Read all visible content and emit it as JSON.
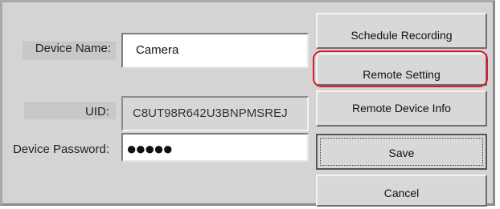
{
  "form": {
    "device_name": {
      "label": "Device Name:",
      "value": "Camera"
    },
    "uid": {
      "label": "UID:",
      "value": "C8UT98R642U3BNPMSREJ"
    },
    "password": {
      "label": "Device Password:",
      "value": "●●●●●"
    }
  },
  "buttons": {
    "schedule_recording": "Schedule Recording",
    "remote_setting": "Remote Setting",
    "remote_device_info": "Remote Device Info",
    "save": "Save",
    "cancel": "Cancel"
  },
  "colors": {
    "highlight": "#e0182a",
    "panel": "#d4d4d4"
  }
}
